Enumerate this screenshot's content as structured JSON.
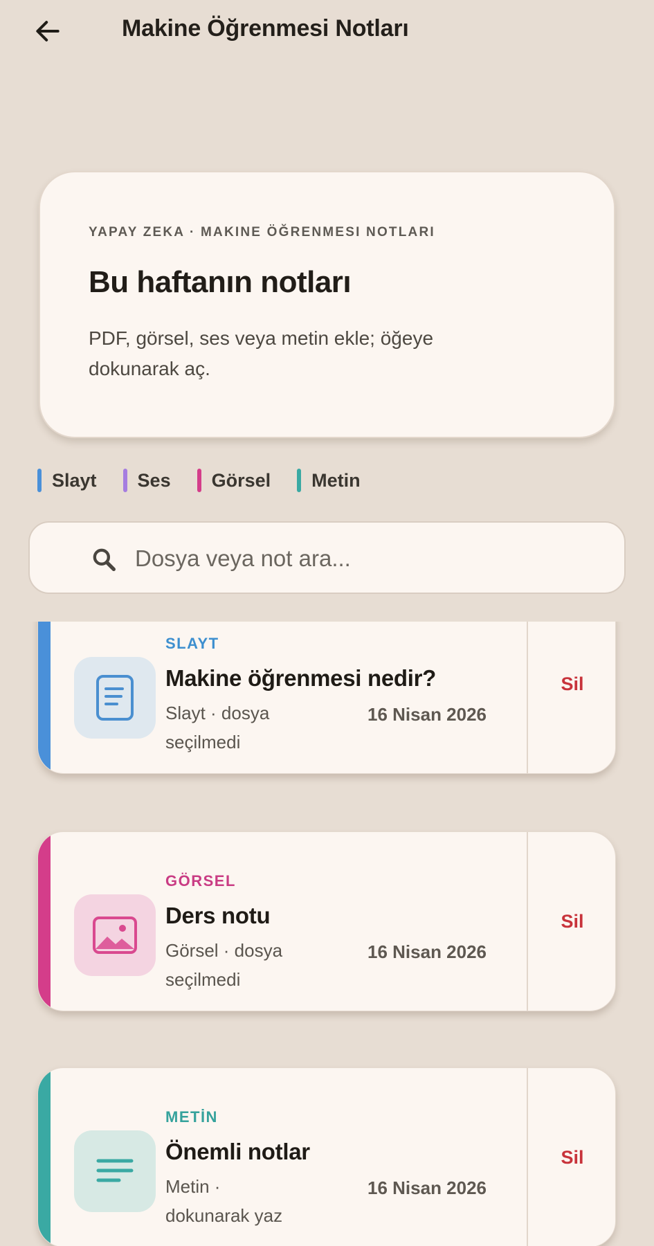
{
  "header": {
    "title": "Makine Öğrenmesi Notları",
    "back_icon": "arrow-left-icon"
  },
  "hero": {
    "eyebrow": "YAPAY ZEKA · MAKINE ÖĞRENMESI NOTLARI",
    "title": "Bu haftanın notları",
    "description": "PDF, görsel, ses veya metin ekle; öğeye dokunarak aç."
  },
  "legend": [
    {
      "label": "Slayt",
      "color": "#4a90d9"
    },
    {
      "label": "Ses",
      "color": "#a57de0"
    },
    {
      "label": "Görsel",
      "color": "#d43d8a"
    },
    {
      "label": "Metin",
      "color": "#3aa9a3"
    }
  ],
  "search": {
    "placeholder": "Dosya veya not ara...",
    "value": ""
  },
  "notes": [
    {
      "kind": "SLAYT",
      "title": "Makine öğrenmesi nedir?",
      "meta": "Slayt · dosya seçilmedi",
      "date": "16 Nisan 2026",
      "delete_label": "Sil",
      "accent": "#4a90d9",
      "kind_color": "#3d8fcf",
      "thumb_bg": "#dfe8ef",
      "icon": "document-icon"
    },
    {
      "kind": "GÖRSEL",
      "title": "Ders notu",
      "meta": "Görsel · dosya seçilmedi",
      "date": "16 Nisan 2026",
      "delete_label": "Sil",
      "accent": "#d43d8a",
      "kind_color": "#c93c84",
      "thumb_bg": "#f4d4e1",
      "icon": "image-icon"
    },
    {
      "kind": "METİN",
      "title": "Önemli notlar",
      "meta": "Metin · dokunarak yaz",
      "date": "16 Nisan 2026",
      "delete_label": "Sil",
      "accent": "#3aa9a3",
      "kind_color": "#35a29c",
      "thumb_bg": "#d7e9e4",
      "icon": "text-lines-icon"
    }
  ]
}
